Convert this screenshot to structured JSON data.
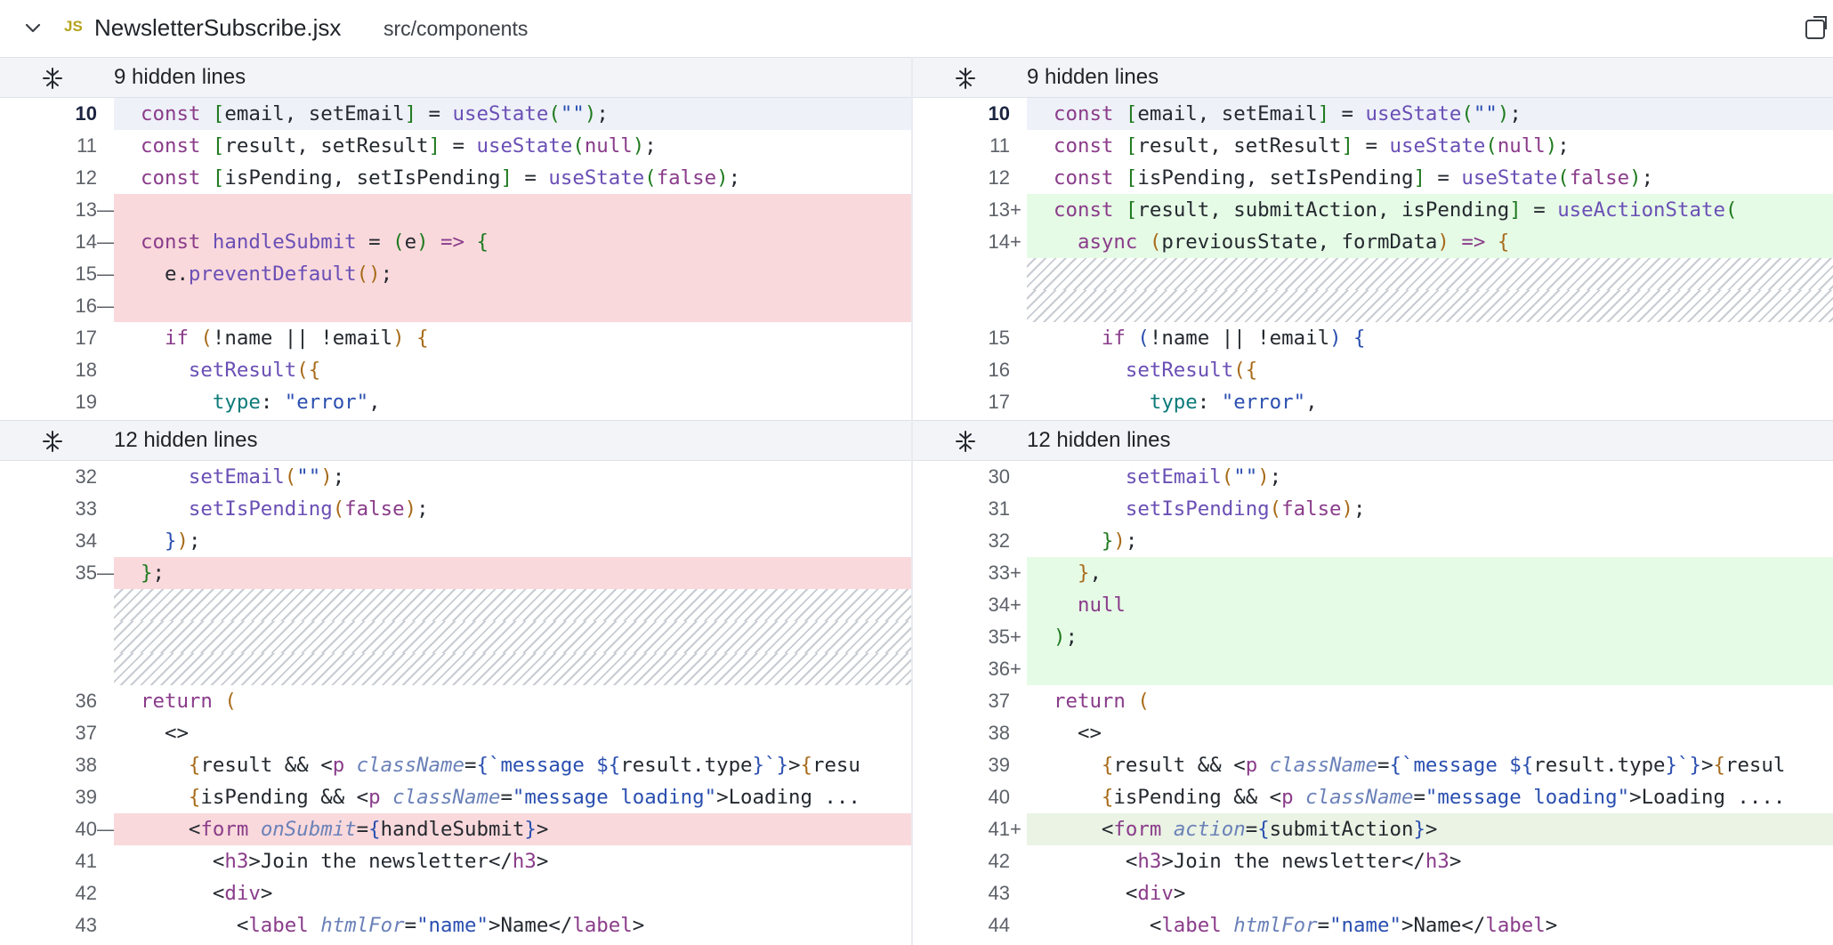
{
  "file": {
    "lang_badge": "JS",
    "name": "NewsletterSubscribe.jsx",
    "path": "src/components"
  },
  "hidden": {
    "top": "9 hidden lines",
    "middle": "12 hidden lines"
  },
  "left": {
    "block1": [
      {
        "n": "10",
        "m": "",
        "type": "cur",
        "html": "<span class=\"k\">const</span> <span class=\"p\">[</span>email, setEmail<span class=\"p\">]</span> = <span class=\"f\">useState</span><span class=\"p\">(</span><span class=\"s\">\"\"</span><span class=\"p\">)</span>;"
      },
      {
        "n": "11",
        "m": "",
        "type": "",
        "html": "<span class=\"k\">const</span> <span class=\"p\">[</span>result, setResult<span class=\"p\">]</span> = <span class=\"f\">useState</span><span class=\"p\">(</span><span class=\"k\">null</span><span class=\"p\">)</span>;"
      },
      {
        "n": "12",
        "m": "",
        "type": "",
        "html": "<span class=\"k\">const</span> <span class=\"p\">[</span>isPending, setIsPending<span class=\"p\">]</span> = <span class=\"f\">useState</span><span class=\"p\">(</span><span class=\"k\">false</span><span class=\"p\">)</span>;"
      },
      {
        "n": "13",
        "m": "—",
        "type": "del",
        "html": ""
      },
      {
        "n": "14",
        "m": "—",
        "type": "del",
        "html": "<span class=\"k\">const</span> <span class=\"f\">handleSubmit</span> = <span class=\"p\">(</span>e<span class=\"p\">)</span> <span class=\"k\">=&gt;</span> <span class=\"p\">{</span>"
      },
      {
        "n": "15",
        "m": "—",
        "type": "del",
        "html": "  e.<span class=\"f\">preventDefault</span><span class=\"pb\">()</span>;"
      },
      {
        "n": "16",
        "m": "—",
        "type": "del",
        "html": ""
      },
      {
        "n": "17",
        "m": "",
        "type": "",
        "html": "  <span class=\"k\">if</span> <span class=\"pb\">(</span>!name || !email<span class=\"pb\">)</span> <span class=\"pb\">{</span>"
      },
      {
        "n": "18",
        "m": "",
        "type": "",
        "html": "    <span class=\"f\">setResult</span><span class=\"pb\">({</span>"
      },
      {
        "n": "19",
        "m": "",
        "type": "",
        "html": "      <span class=\"pr\">type</span>: <span class=\"s\">\"error\"</span>,"
      }
    ],
    "block2": [
      {
        "n": "32",
        "m": "",
        "type": "",
        "html": "    <span class=\"f\">setEmail</span><span class=\"pb\">(</span><span class=\"s\">\"\"</span><span class=\"pb\">)</span>;"
      },
      {
        "n": "33",
        "m": "",
        "type": "",
        "html": "    <span class=\"f\">setIsPending</span><span class=\"pb\">(</span><span class=\"k\">false</span><span class=\"pb\">)</span>;"
      },
      {
        "n": "34",
        "m": "",
        "type": "",
        "html": "  <span class=\"s\">}</span><span class=\"pb\">)</span>;"
      },
      {
        "n": "35",
        "m": "—",
        "type": "del",
        "html": "<span class=\"p\">}</span>;"
      },
      {
        "n": "",
        "m": "",
        "type": "hatch",
        "html": ""
      },
      {
        "n": "",
        "m": "",
        "type": "hatch",
        "html": ""
      },
      {
        "n": "",
        "m": "",
        "type": "hatch",
        "html": ""
      },
      {
        "n": "36",
        "m": "",
        "type": "",
        "html": "<span class=\"k\">return</span> <span class=\"pb\">(</span>"
      },
      {
        "n": "37",
        "m": "",
        "type": "",
        "html": "  &lt;&gt;"
      },
      {
        "n": "38",
        "m": "",
        "type": "",
        "html": "    <span class=\"pb\">{</span>result &amp;&amp; &lt;<span class=\"t\">p</span> <span class=\"a\">className</span>=<span class=\"s\">{`message ${</span>result.type<span class=\"s\">}`}</span>&gt;<span class=\"pb\">{</span>resu"
      },
      {
        "n": "39",
        "m": "",
        "type": "",
        "html": "    <span class=\"pb\">{</span>isPending &amp;&amp; &lt;<span class=\"t\">p</span> <span class=\"a\">className</span>=<span class=\"s\">\"message loading\"</span>&gt;Loading ..."
      },
      {
        "n": "40",
        "m": "—",
        "type": "del",
        "html": "    &lt;<span class=\"t\">form</span> <span class=\"a\">onSubmit</span>=<span class=\"s\">{</span>handleSubmit<span class=\"s\">}</span>&gt;"
      },
      {
        "n": "41",
        "m": "",
        "type": "",
        "html": "      &lt;<span class=\"t\">h3</span>&gt;Join the newsletter&lt;/<span class=\"t\">h3</span>&gt;"
      },
      {
        "n": "42",
        "m": "",
        "type": "",
        "html": "      &lt;<span class=\"t\">div</span>&gt;"
      },
      {
        "n": "43",
        "m": "",
        "type": "",
        "html": "        &lt;<span class=\"t\">label</span> <span class=\"a\">htmlFor</span>=<span class=\"s\">\"name\"</span>&gt;Name&lt;/<span class=\"t\">label</span>&gt;"
      }
    ]
  },
  "right": {
    "block1": [
      {
        "n": "10",
        "m": "",
        "type": "cur",
        "html": "<span class=\"k\">const</span> <span class=\"p\">[</span>email, setEmail<span class=\"p\">]</span> = <span class=\"f\">useState</span><span class=\"p\">(</span><span class=\"s\">\"\"</span><span class=\"p\">)</span>;"
      },
      {
        "n": "11",
        "m": "",
        "type": "",
        "html": "<span class=\"k\">const</span> <span class=\"p\">[</span>result, setResult<span class=\"p\">]</span> = <span class=\"f\">useState</span><span class=\"p\">(</span><span class=\"k\">null</span><span class=\"p\">)</span>;"
      },
      {
        "n": "12",
        "m": "",
        "type": "",
        "html": "<span class=\"k\">const</span> <span class=\"p\">[</span>isPending, setIsPending<span class=\"p\">]</span> = <span class=\"f\">useState</span><span class=\"p\">(</span><span class=\"k\">false</span><span class=\"p\">)</span>;"
      },
      {
        "n": "13",
        "m": "+",
        "type": "add",
        "html": "<span class=\"k\">const</span> <span class=\"p\">[</span>result, submitAction, isPending<span class=\"p\">]</span> = <span class=\"f\">useActionState</span><span class=\"p\">(</span>"
      },
      {
        "n": "14",
        "m": "+",
        "type": "add",
        "html": "  <span class=\"k\">async</span> <span class=\"pb\">(</span>previousState, formData<span class=\"pb\">)</span> <span class=\"k\">=&gt;</span> <span class=\"pb\">{</span>"
      },
      {
        "n": "",
        "m": "",
        "type": "hatch",
        "html": ""
      },
      {
        "n": "",
        "m": "",
        "type": "hatch",
        "html": ""
      },
      {
        "n": "15",
        "m": "",
        "type": "",
        "html": "    <span class=\"k\">if</span> <span class=\"s\">(</span>!name || !email<span class=\"s\">)</span> <span class=\"s\">{</span>"
      },
      {
        "n": "16",
        "m": "",
        "type": "",
        "html": "      <span class=\"f\">setResult</span><span class=\"pb\">({</span>"
      },
      {
        "n": "17",
        "m": "",
        "type": "",
        "html": "        <span class=\"pr\">type</span>: <span class=\"s\">\"error\"</span>,"
      }
    ],
    "block2": [
      {
        "n": "30",
        "m": "",
        "type": "",
        "html": "      <span class=\"f\">setEmail</span><span class=\"pb\">(</span><span class=\"s\">\"\"</span><span class=\"pb\">)</span>;"
      },
      {
        "n": "31",
        "m": "",
        "type": "",
        "html": "      <span class=\"f\">setIsPending</span><span class=\"pb\">(</span><span class=\"k\">false</span><span class=\"pb\">)</span>;"
      },
      {
        "n": "32",
        "m": "",
        "type": "",
        "html": "    <span class=\"p\">}</span><span class=\"pb\">)</span>;"
      },
      {
        "n": "33",
        "m": "+",
        "type": "add",
        "html": "  <span class=\"pb\">}</span>,"
      },
      {
        "n": "34",
        "m": "+",
        "type": "add",
        "html": "  <span class=\"k\">null</span>"
      },
      {
        "n": "35",
        "m": "+",
        "type": "add",
        "html": "<span class=\"p\">)</span>;"
      },
      {
        "n": "36",
        "m": "+",
        "type": "add",
        "html": ""
      },
      {
        "n": "37",
        "m": "",
        "type": "",
        "html": "<span class=\"k\">return</span> <span class=\"pb\">(</span>"
      },
      {
        "n": "38",
        "m": "",
        "type": "",
        "html": "  &lt;&gt;"
      },
      {
        "n": "39",
        "m": "",
        "type": "",
        "html": "    <span class=\"pb\">{</span>result &amp;&amp; &lt;<span class=\"t\">p</span> <span class=\"a\">className</span>=<span class=\"s\">{`message ${</span>result.type<span class=\"s\">}`}</span>&gt;<span class=\"pb\">{</span>resul"
      },
      {
        "n": "40",
        "m": "",
        "type": "",
        "html": "    <span class=\"pb\">{</span>isPending &amp;&amp; &lt;<span class=\"t\">p</span> <span class=\"a\">className</span>=<span class=\"s\">\"message loading\"</span>&gt;Loading ...."
      },
      {
        "n": "41",
        "m": "+",
        "type": "addw",
        "html": "    &lt;<span class=\"t\">form</span> <span class=\"a\">action</span>=<span class=\"s\">{</span>submitAction<span class=\"s\">}</span>&gt;"
      },
      {
        "n": "42",
        "m": "",
        "type": "",
        "html": "      &lt;<span class=\"t\">h3</span>&gt;Join the newsletter&lt;/<span class=\"t\">h3</span>&gt;"
      },
      {
        "n": "43",
        "m": "",
        "type": "",
        "html": "      &lt;<span class=\"t\">div</span>&gt;"
      },
      {
        "n": "44",
        "m": "",
        "type": "",
        "html": "        &lt;<span class=\"t\">label</span> <span class=\"a\">htmlFor</span>=<span class=\"s\">\"name\"</span>&gt;Name&lt;/<span class=\"t\">label</span>&gt;"
      }
    ]
  }
}
